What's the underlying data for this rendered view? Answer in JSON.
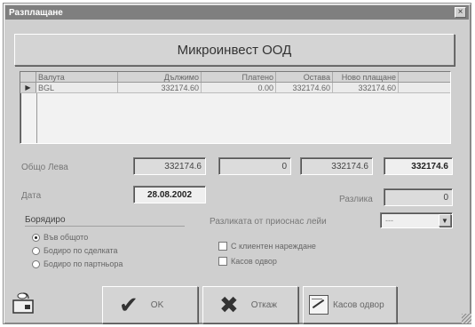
{
  "window": {
    "title": "Разплащане",
    "close_glyph": "×"
  },
  "company_name": "Микроинвест ООД",
  "grid": {
    "indicator": "▶",
    "columns": [
      "Валута",
      "Дължимо",
      "Платено",
      "Остава",
      "Ново плащане"
    ],
    "rows": [
      {
        "currency": "BGL",
        "due": "332174.60",
        "paid": "0.00",
        "remaining": "332174.60",
        "new_payment": "332174.60"
      }
    ]
  },
  "totals": {
    "label": "Общо Лева",
    "due": "332174.6",
    "paid": "0",
    "remaining": "332174.6",
    "new_payment": "332174.6"
  },
  "date": {
    "label": "Дата",
    "value": "28.08.2002"
  },
  "difference": {
    "label": "Разлика",
    "value": "0"
  },
  "ordering": {
    "label": "Борядиро",
    "options": [
      "Във общото",
      "Бодиро по сделката",
      "Бодиро по партньора"
    ],
    "selected_index": 0
  },
  "difference_to": {
    "label": "Разликата от приоснас лейи",
    "value": "---"
  },
  "checkboxes": [
    {
      "label": "С клиентен нареждане",
      "checked": false
    },
    {
      "label": "Касов одвор",
      "checked": false
    }
  ],
  "buttons": {
    "ok": {
      "label": "OK",
      "glyph": "✔"
    },
    "cancel": {
      "label": "Откаж",
      "glyph": "✖"
    },
    "cash": {
      "label": "Касов одвор"
    }
  },
  "colors": {
    "title_bar": "#7f7f7f",
    "window_bg": "#cfcfcf"
  }
}
